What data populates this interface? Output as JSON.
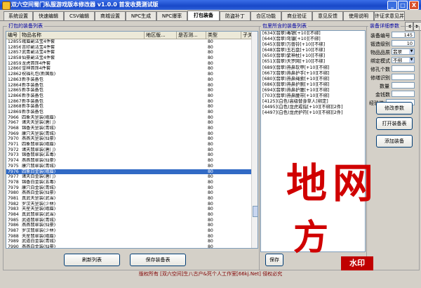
{
  "window": {
    "title": "双六空间蜀门私服游戏版本修改器  v1.0.0  首发收费测试版",
    "minimize": "_",
    "maximize": "□",
    "close": "X"
  },
  "tabs": [
    "系统设置",
    "快速编辑",
    "CSV编辑",
    "商城设置",
    "NPC生成",
    "NPC爆率",
    "打包装备",
    "防盗补丁",
    "合区功能",
    "商业验证",
    "意见反馈",
    "使用说明",
    "许证求意见并放精关君目"
  ],
  "left_panel": {
    "title": "打包的装备列表",
    "columns": [
      "编号",
      "物品名称",
      "地区版...",
      "是否测...",
      "类型",
      "子关"
    ],
    "rows": [
      [
        "12855",
        "峨眉副法宝4件套",
        "",
        "",
        "80"
      ],
      [
        "12856",
        "吉印副法宝4件套",
        "",
        "",
        "80"
      ],
      [
        "12857",
        "武青副法宝4件套",
        "",
        "",
        "80"
      ],
      [
        "12858",
        "仙豪副法宝4件套",
        "",
        "",
        "80"
      ],
      [
        "12859",
        "龙虎首饰4件套",
        "",
        "",
        "80"
      ],
      [
        "12860",
        "雪神首饰4件套",
        "",
        "",
        "80"
      ],
      [
        "12862",
        "祝福礼包(新国版)",
        "",
        "",
        "80"
      ],
      [
        "12863",
        "新手装备包",
        "",
        "",
        "80"
      ],
      [
        "12864",
        "新手装备包",
        "",
        "",
        "80"
      ],
      [
        "12865",
        "新手装备包",
        "",
        "",
        "80"
      ],
      [
        "12866",
        "新手装备包",
        "",
        "",
        "80"
      ],
      [
        "12867",
        "新手装备包",
        "",
        "",
        "80"
      ],
      [
        "12868",
        "新手装备包",
        "",
        "",
        "80"
      ],
      [
        "12869",
        "新手装备包",
        "",
        "",
        "80"
      ],
      [
        "7966",
        "四象天罡装(峨眉)",
        "",
        "",
        "80"
      ],
      [
        "7967",
        "诸天天罡装(唐门)",
        "",
        "",
        "80"
      ],
      [
        "7968",
        "锦香天罡装(青城)",
        "",
        "",
        "80"
      ],
      [
        "7969",
        "康穴天罡装(青城)",
        "",
        "",
        "80"
      ],
      [
        "7970",
        "燕燕天罡装(仙豪)",
        "",
        "",
        "80"
      ],
      [
        "7971",
        "四象翡翠装(峨眉)",
        "",
        "",
        "80"
      ],
      [
        "7972",
        "诸天翡翠装(唐门)",
        "",
        "",
        "80"
      ],
      [
        "7973",
        "锦香翡翠装(五毒)",
        "",
        "",
        "80"
      ],
      [
        "7974",
        "燕燕翡翠装(仙豪)",
        "",
        "",
        "80"
      ],
      [
        "7975",
        "康穴翡翠装(青城)",
        "",
        "",
        "80"
      ],
      [
        "7976",
        "四象白金装(峨眉)",
        "",
        "",
        "80"
      ],
      [
        "7977",
        "诸天白金装(唐门)",
        "",
        "",
        "80"
      ],
      [
        "7978",
        "锦香白金装(五毒)",
        "",
        "",
        "80"
      ],
      [
        "7979",
        "康穴白金装(青城)",
        "",
        "",
        "80"
      ],
      [
        "7980",
        "燕燕白金装(仙豪)",
        "",
        "",
        "80"
      ],
      [
        "7981",
        "真武天罡装(武当)",
        "",
        "",
        "80"
      ],
      [
        "7982",
        "罗汉天罡装(少林)",
        "",
        "",
        "80"
      ],
      [
        "7983",
        "天星天罡装(峨眉)",
        "",
        "",
        "80"
      ],
      [
        "7984",
        "真武翡翠装(武当)",
        "",
        "",
        "80"
      ],
      [
        "7985",
        "武道翡翠装(青城)",
        "",
        "",
        "80"
      ],
      [
        "7986",
        "燕燕翡翠装(仙豪)",
        "",
        "",
        "80"
      ],
      [
        "7987",
        "罗汉翡翠装(少林)",
        "",
        "",
        "80"
      ],
      [
        "7988",
        "天星翡翠装(峨眉)",
        "",
        "",
        "80"
      ],
      [
        "7989",
        "武道白金装(青城)",
        "",
        "",
        "80"
      ],
      [
        "7990",
        "燕燕白金装(仙豪)",
        "",
        "",
        "80"
      ]
    ],
    "selected_index": 24,
    "refresh_button": "刷新列表",
    "save_button": "保存装备表"
  },
  "middle_panel": {
    "title": "包里所含的装备列表",
    "lines": [
      "[634](翡翠)毒镖[+10][不绑]",
      "[644](翡翠)弯镰[+10][不绑]",
      "[645](翡翠)万兽铃[+10][不绑]",
      "[648](翡翠)玉石盘[+10][不绑]",
      "[650](翡翠)紫神杖[+10][不绑]",
      "[651](翡翠)天罗网[+10][不绑]",
      "[689](翡翠)燕鼻软甲[+10][不绑]",
      "[667](翡翠)燕鼻护手[+10][不绑]",
      "[680](翡翠)燕鼻绳索[+10][不绑]",
      "[686](翡翠)燕鼻护腕[+10][不绑]",
      "[694](翡翠)燕鼻护腰[+10][不绑]",
      "[703](翡翠)燕鼻腰带[+10][不绑]",
      "[4125](白色)高级替身草人[绑定]",
      "[4495](白色)龙虎戒指[+10][不绑][2件]",
      "[4497](白色)龙虎护符[+10][不绑][2件]"
    ],
    "save_button": "保存"
  },
  "right_panel": {
    "title": "装备详细参数",
    "fields": [
      {
        "label": "装备编号",
        "value": "145"
      },
      {
        "label": "锻造级别",
        "value": "10"
      },
      {
        "label": "物品品质",
        "value": "翡翠",
        "type": "select"
      },
      {
        "label": "绑定模式",
        "value": "不绑",
        "type": "select"
      },
      {
        "label": "修孔个数",
        "value": ""
      },
      {
        "label": "修缮识别",
        "value": ""
      },
      {
        "label": "数量",
        "value": ""
      },
      {
        "label": "金钱数",
        "value": ""
      },
      {
        "label": "经验值",
        "value": ""
      }
    ],
    "buttons": [
      "修改参数",
      "打开装备表",
      "添加装备"
    ]
  },
  "footer": "版权所有 [双六空间]生八古户&死个人工作室[66kj.Net] 侵权必究",
  "watermark": {
    "line1": "地网",
    "line2": "方",
    "badge": "水印"
  }
}
